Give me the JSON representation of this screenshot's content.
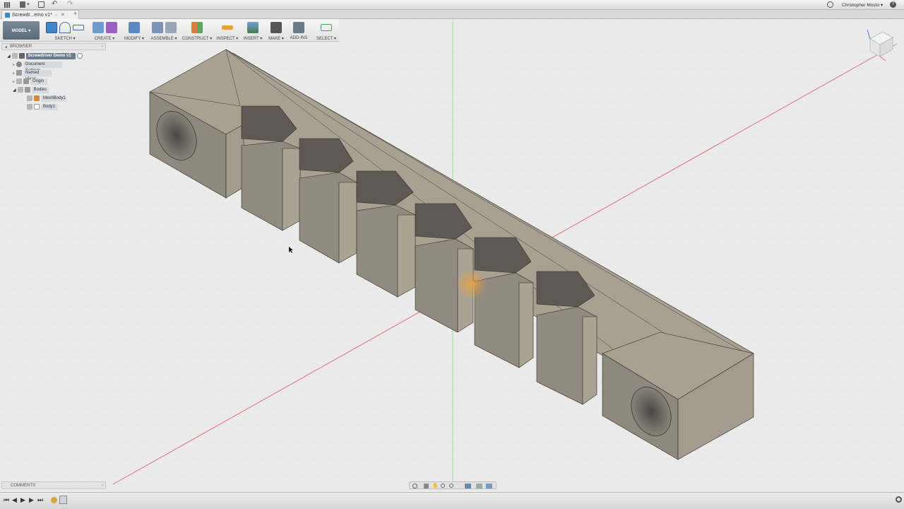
{
  "app": {
    "tab_title": "Screwdr...emo v1*",
    "user_name": "Christopher Mosto ▾",
    "mode_label": "MODEL ▾"
  },
  "toolbar": {
    "sketch": "SKETCH ▾",
    "create": "CREATE ▾",
    "modify": "MODIFY ▾",
    "assemble": "ASSEMBLE ▾",
    "construct": "CONSTRUCT ▾",
    "inspect": "INSPECT ▾",
    "insert": "INSERT ▾",
    "make": "MAKE ▾",
    "addins": "ADD-INS",
    "select": "SELECT ▾"
  },
  "browser": {
    "header": "BROWSER",
    "items": [
      {
        "label": "Screwdriver Demo v1"
      },
      {
        "label": "Document Settings"
      },
      {
        "label": "Named Views"
      },
      {
        "label": "Origin"
      },
      {
        "label": "Bodies"
      },
      {
        "label": "MeshBody1"
      },
      {
        "label": "Body1"
      }
    ]
  },
  "comments": {
    "label": "COMMENTS"
  },
  "colors": {
    "model_face": "#a39a8c",
    "accent_blue": "#3f86c8",
    "axis_red": "#e0707a",
    "axis_green": "#8ccf8c"
  },
  "icons": [
    "grid-icon",
    "file-icon",
    "save-icon",
    "undo-icon",
    "redo-icon",
    "clock-icon",
    "help-icon",
    "gear-icon"
  ]
}
